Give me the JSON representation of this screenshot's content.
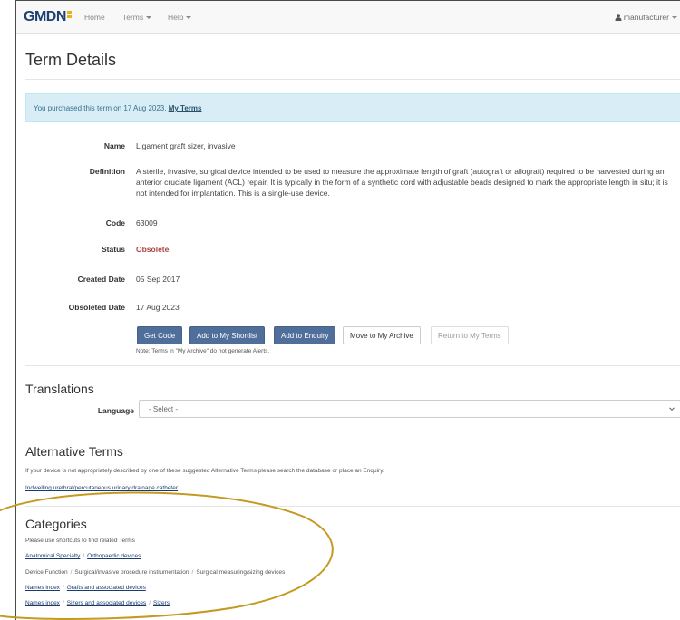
{
  "navbar": {
    "brand": "GMDN",
    "items": [
      {
        "label": "Home",
        "dropdown": false
      },
      {
        "label": "Terms",
        "dropdown": true
      },
      {
        "label": "Help",
        "dropdown": true
      }
    ],
    "user": "manufacturer"
  },
  "page_title": "Term Details",
  "alert": {
    "text": "You purchased this term on 17 Aug 2023.",
    "link": "My Terms"
  },
  "details": {
    "name_label": "Name",
    "name_value": "Ligament graft sizer, invasive",
    "definition_label": "Definition",
    "definition_value": "A sterile, invasive, surgical device intended to be used to measure the approximate length of graft (autograft or allograft) required to be harvested during an anterior cruciate ligament (ACL) repair. It is typically in the form of a synthetic cord with adjustable beads designed to mark the appropriate length in situ; it is not intended for implantation. This is a single-use device.",
    "code_label": "Code",
    "code_value": "63009",
    "status_label": "Status",
    "status_value": "Obsolete",
    "created_label": "Created Date",
    "created_value": "05 Sep 2017",
    "obsoleted_label": "Obsoleted Date",
    "obsoleted_value": "17 Aug 2023"
  },
  "buttons": {
    "get_code": "Get Code",
    "add_shortlist": "Add to My Shortlist",
    "add_enquiry": "Add to Enquiry",
    "move_archive": "Move to My Archive",
    "return_terms": "Return to My Terms"
  },
  "note": "Note: Terms in \"My Archive\" do not generate Alerts.",
  "translations": {
    "title": "Translations",
    "language_label": "Language",
    "select_value": "- Select -"
  },
  "alternative_terms": {
    "title": "Alternative Terms",
    "help": "If your device is not appropriately described by one of these suggested Alternative Terms please search the database or place an Enquiry.",
    "link": "Indwelling urethral/percutaneous urinary drainage catheter"
  },
  "categories": {
    "title": "Categories",
    "help": "Please use shortcuts to find related Terms",
    "lines": [
      [
        "Anatomical Specialty",
        "Orthopaedic devices"
      ],
      [
        "Device Function",
        "Surgical/invasive procedure instrumentation",
        "Surgical measuring/sizing devices"
      ],
      [
        "Names index",
        "Grafts and associated devices"
      ],
      [
        "Names index",
        "Sizers and associated devices",
        "Sizers"
      ]
    ]
  },
  "colors": {
    "brand": "#1d3f74",
    "brand_accent": "#e8b21a",
    "alert_bg": "#d9edf7",
    "primary_button": "#4f6f9a",
    "obsolete": "#a94442",
    "annotation": "#c49a22"
  }
}
